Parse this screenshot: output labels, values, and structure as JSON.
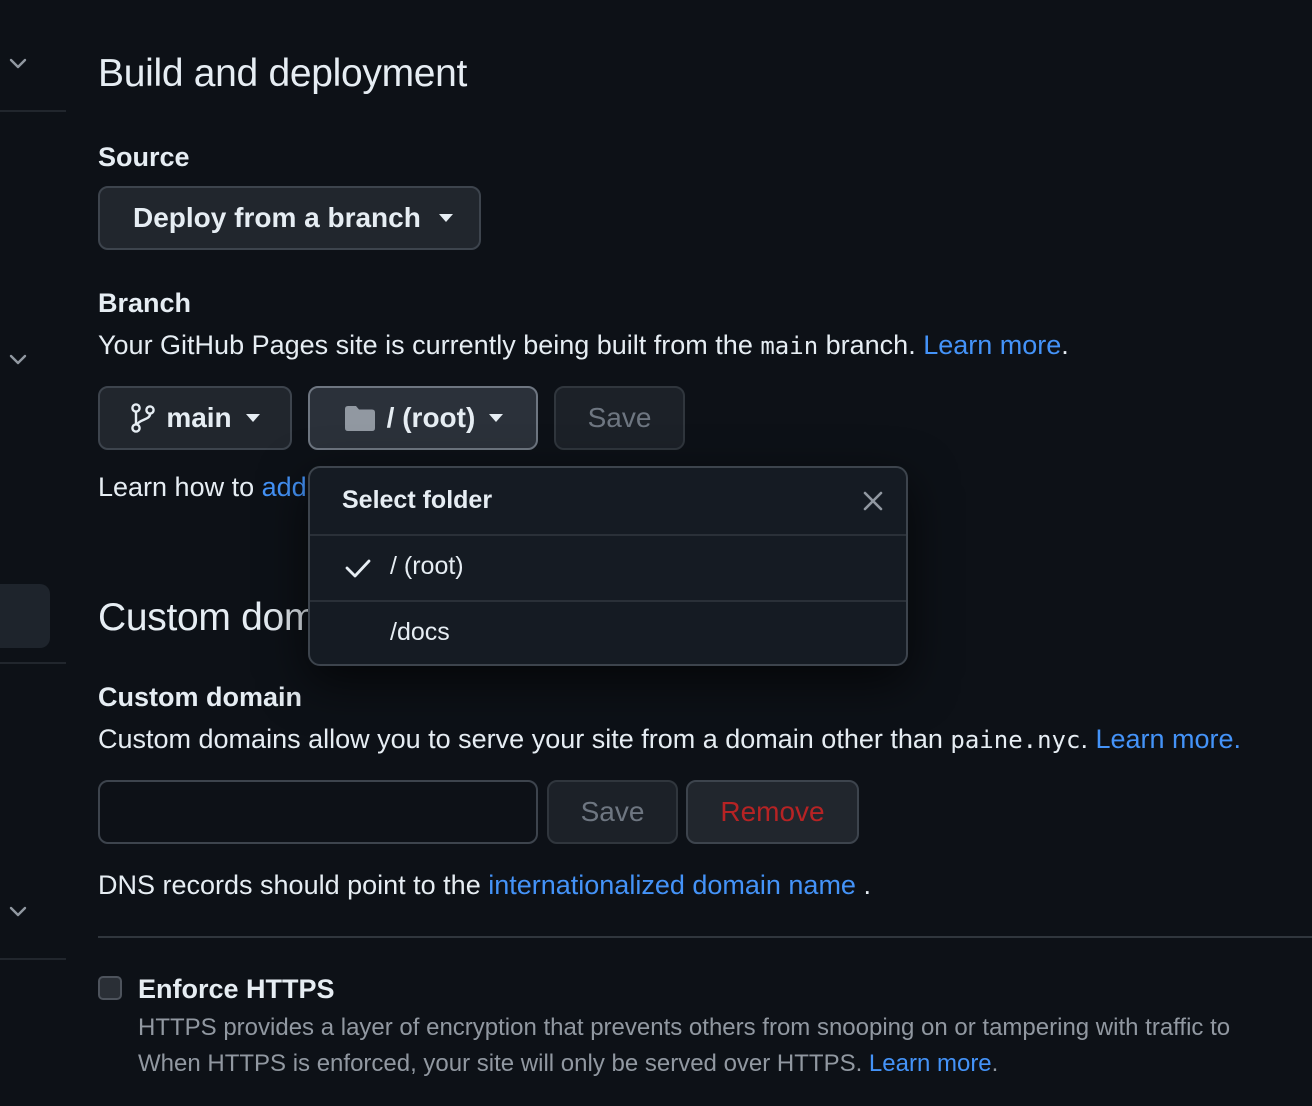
{
  "sections": {
    "build": {
      "title": "Build and deployment",
      "source_label": "Source",
      "source_select": "Deploy from a branch",
      "branch_label": "Branch",
      "branch_desc_pre": "Your GitHub Pages site is currently being built from the ",
      "branch_desc_code": "main",
      "branch_desc_post": " branch. ",
      "branch_learn_more": "Learn more",
      "branch_desc_end": ".",
      "branch_button": "main",
      "folder_button": "/ (root)",
      "save_button": "Save",
      "learn_how_pre": "Learn how to ",
      "learn_how_link": "add"
    },
    "custom": {
      "title": "Custom domain",
      "field_label": "Custom domain",
      "desc_pre": "Custom domains allow you to serve your site from a domain other than ",
      "desc_code": "paine.nyc",
      "desc_mid": ". ",
      "desc_link": "Learn more.",
      "domain_input_value": "",
      "save_button": "Save",
      "remove_button": "Remove",
      "dns_pre": "DNS records should point to the ",
      "dns_link": "internationalized domain name",
      "dns_post": " ."
    },
    "https": {
      "label": "Enforce HTTPS",
      "checked": false,
      "desc_line1": "HTTPS provides a layer of encryption that prevents others from snooping on or tampering with traffic to",
      "desc_line2_pre": "When HTTPS is enforced, your site will only be served over HTTPS. ",
      "desc_line2_link": "Learn more",
      "desc_line2_end": "."
    }
  },
  "folder_menu": {
    "title": "Select folder",
    "items": [
      {
        "label": "/ (root)",
        "selected": true
      },
      {
        "label": "/docs",
        "selected": false
      }
    ]
  },
  "colors": {
    "background": "#0d1117",
    "text": "#e6edf3",
    "link": "#4493f8",
    "danger": "#b62324",
    "border": "#3d444d"
  },
  "icons": [
    "chevron-down-icon",
    "git-branch-icon",
    "folder-icon",
    "check-icon",
    "close-icon"
  ]
}
